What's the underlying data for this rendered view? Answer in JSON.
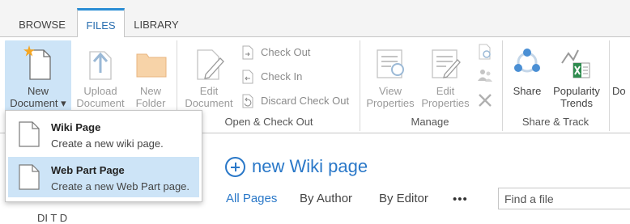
{
  "tabs": [
    {
      "label": "BROWSE"
    },
    {
      "label": "FILES"
    },
    {
      "label": "LIBRARY"
    }
  ],
  "ribbon": {
    "new_document": {
      "line1": "New",
      "line2": "Document",
      "arrow": "▾"
    },
    "upload_document": {
      "line1": "Upload",
      "line2": "Document"
    },
    "new_folder": {
      "line1": "New",
      "line2": "Folder"
    },
    "edit_document": {
      "line1": "Edit",
      "line2": "Document"
    },
    "check_out": "Check Out",
    "check_in": "Check In",
    "discard_check_out": "Discard Check Out",
    "group_open_checkout": "Open & Check Out",
    "view_properties": {
      "line1": "View",
      "line2": "Properties"
    },
    "edit_properties": {
      "line1": "Edit",
      "line2": "Properties"
    },
    "group_manage": "Manage",
    "share": "Share",
    "popularity_trends": {
      "line1": "Popularity",
      "line2": "Trends"
    },
    "group_share_track": "Share & Track",
    "download_partial": "Do"
  },
  "dropdown": {
    "items": [
      {
        "title": "Wiki Page",
        "description": "Create a new wiki page."
      },
      {
        "title": "Web Part Page",
        "description": "Create a new Web Part page."
      }
    ]
  },
  "content": {
    "new_wiki_page": "new Wiki page",
    "views": [
      "All Pages",
      "By Author",
      "By Editor"
    ],
    "more": "•••",
    "search_placeholder": "Find a file",
    "partial_text": "DI  T   D"
  },
  "colors": {
    "accent": "#2a78c8",
    "tab_accent": "#2a8dd4",
    "selected_bg": "#cde4f7"
  }
}
